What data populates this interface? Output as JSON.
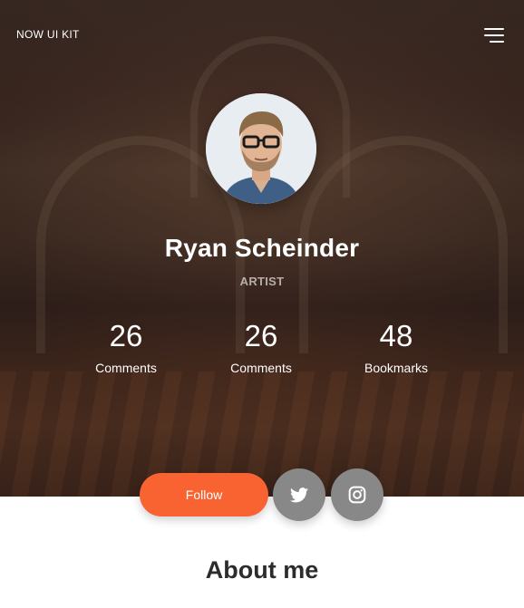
{
  "navbar": {
    "brand": "NOW UI KIT",
    "menu_icon": "hamburger-menu-icon"
  },
  "profile": {
    "name": "Ryan Scheinder",
    "role": "ARTIST",
    "avatar_icon": "profile-photo"
  },
  "stats": [
    {
      "value": "26",
      "label": "Comments"
    },
    {
      "value": "26",
      "label": "Comments"
    },
    {
      "value": "48",
      "label": "Bookmarks"
    }
  ],
  "actions": {
    "follow_label": "Follow",
    "twitter_icon": "twitter-icon",
    "instagram_icon": "instagram-icon"
  },
  "about": {
    "title": "About me"
  },
  "colors": {
    "accent": "#f96332",
    "social_button": "#888888",
    "heading": "#2c2c2c"
  }
}
